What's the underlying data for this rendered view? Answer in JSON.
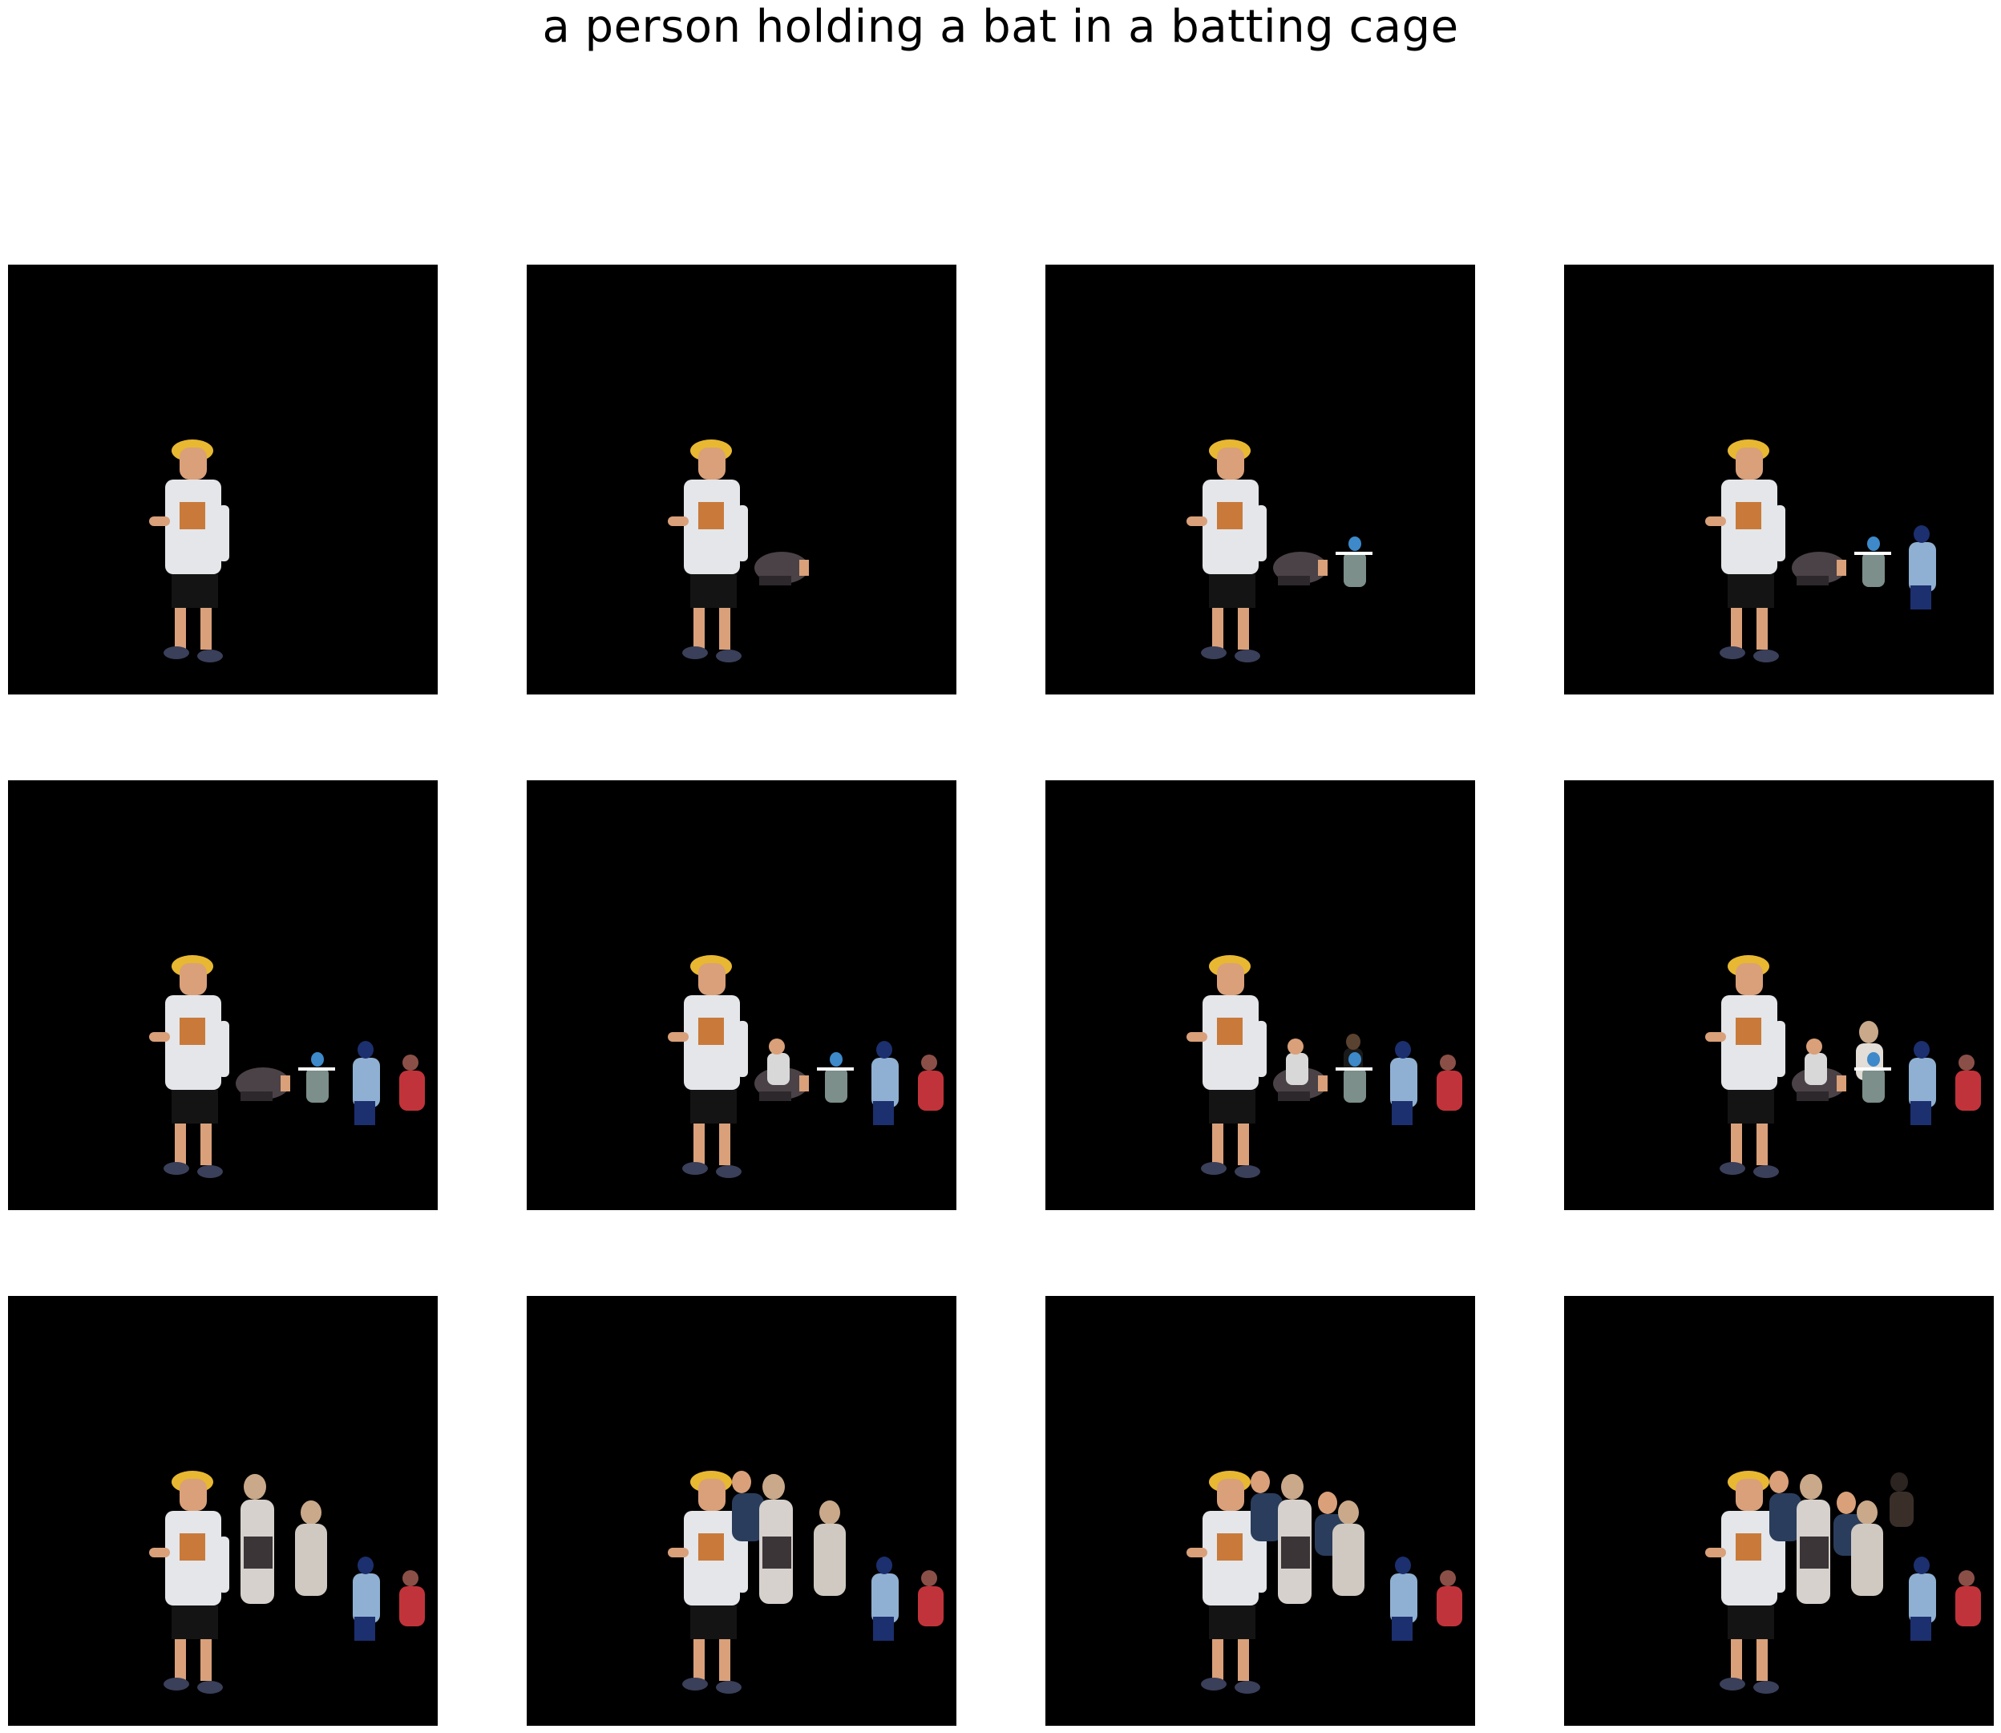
{
  "figure": {
    "title": "a person holding a bat in a batting cage"
  },
  "colors": {
    "background": "#ffffff",
    "panel": "#000000",
    "cap": "#e8b832",
    "shirt": "#e4e6ea",
    "shorts": "#141414",
    "skin": "#d9a07a",
    "dark_blue": "#1c2f6e",
    "light_blue": "#8fb0d2",
    "red": "#c1333a",
    "teal_grey": "#7c8f8a",
    "brown": "#5a4230"
  },
  "panels": [
    {
      "index": 1,
      "figures": [
        "boy"
      ]
    },
    {
      "index": 2,
      "figures": [
        "boy",
        "bag"
      ]
    },
    {
      "index": 3,
      "figures": [
        "boy",
        "bag",
        "crouch"
      ]
    },
    {
      "index": 4,
      "figures": [
        "boy",
        "bag",
        "crouch",
        "blue"
      ]
    },
    {
      "index": 5,
      "figures": [
        "boy",
        "bag",
        "crouch",
        "blue",
        "red"
      ]
    },
    {
      "index": 6,
      "figures": [
        "boy",
        "bag",
        "white",
        "crouch",
        "blue",
        "red"
      ]
    },
    {
      "index": 7,
      "figures": [
        "boy",
        "bag",
        "white",
        "dark",
        "crouch",
        "blue",
        "red"
      ]
    },
    {
      "index": 8,
      "figures": [
        "boy",
        "bag",
        "white",
        "girl",
        "crouch",
        "blue",
        "red"
      ]
    },
    {
      "index": 9,
      "figures": [
        "boy",
        "crowd1",
        "crowd2",
        "blue",
        "red"
      ]
    },
    {
      "index": 10,
      "figures": [
        "boy",
        "navy1",
        "crowd1",
        "crowd2",
        "blue",
        "red"
      ]
    },
    {
      "index": 11,
      "figures": [
        "boy",
        "navy1",
        "crowd1",
        "navy2",
        "crowd2",
        "blue",
        "red"
      ]
    },
    {
      "index": 12,
      "figures": [
        "boy",
        "navy1",
        "crowd1",
        "navy2",
        "dark2",
        "crowd2",
        "blue",
        "red"
      ]
    }
  ]
}
